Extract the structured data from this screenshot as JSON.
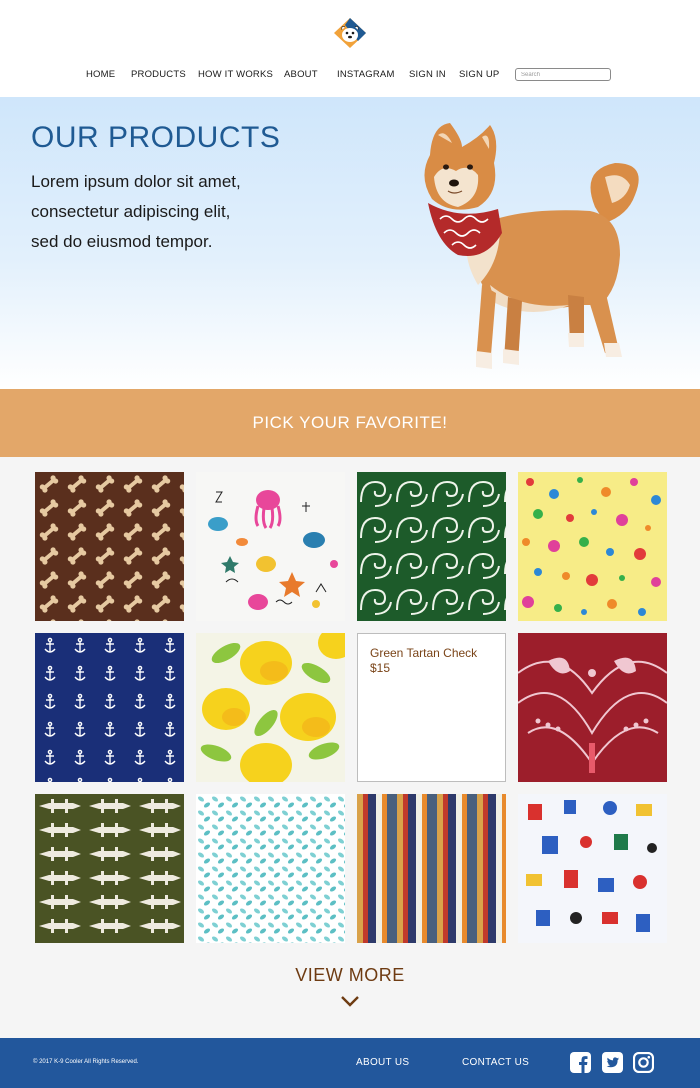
{
  "brand": {
    "logo_icon": "dog-face-logo-icon"
  },
  "nav": {
    "items": [
      {
        "label": "HOME"
      },
      {
        "label": "PRODUCTS"
      },
      {
        "label": "HOW IT WORKS"
      },
      {
        "label": "ABOUT"
      },
      {
        "label": "INSTAGRAM"
      },
      {
        "label": "SIGN IN"
      },
      {
        "label": "SIGN UP"
      }
    ],
    "search_placeholder": "Search"
  },
  "hero": {
    "title": "OUR PRODUCTS",
    "body_lines": [
      "Lorem ipsum dolor sit amet,",
      "consectetur adipiscing elit,",
      "sed do eiusmod tempor."
    ],
    "image": "shiba-dog-wearing-bandana-photo"
  },
  "banner": {
    "text": "PICK YOUR FAVORITE!"
  },
  "products": {
    "tiles": [
      {
        "pattern": "dog-bones-on-brown"
      },
      {
        "pattern": "sea-creatures-doodle"
      },
      {
        "pattern": "green-swirl"
      },
      {
        "pattern": "polka-dots-on-yellow"
      },
      {
        "pattern": "anchors-on-navy"
      },
      {
        "pattern": "lemons"
      },
      {
        "pattern": "info-card",
        "name": "Green Tartan Check",
        "price": "$15"
      },
      {
        "pattern": "red-paisley"
      },
      {
        "pattern": "crocodiles-on-olive"
      },
      {
        "pattern": "teal-leaves"
      },
      {
        "pattern": "vertical-stripes"
      },
      {
        "pattern": "robots-on-white"
      }
    ],
    "view_more": "VIEW MORE"
  },
  "colors": {
    "title_blue": "#1f5a93",
    "banner_orange": "#e3a769",
    "footer_blue": "#22579c",
    "view_more_brown": "#6e3b12"
  },
  "footer": {
    "copyright": "© 2017 K-9 Cooler All Rights Reserved.",
    "about": "ABOUT US",
    "contact": "CONTACT US",
    "social": [
      "facebook-icon",
      "twitter-icon",
      "instagram-icon"
    ]
  }
}
